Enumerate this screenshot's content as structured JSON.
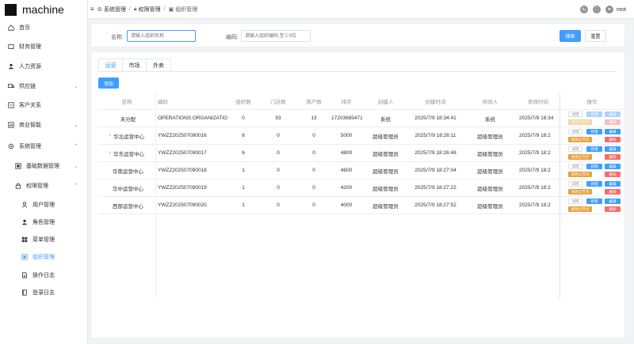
{
  "app": {
    "logo_text": "machine"
  },
  "sidebar": {
    "items": [
      {
        "label": "首页",
        "icon": "home-icon"
      },
      {
        "label": "财务管理",
        "icon": "wallet-icon"
      },
      {
        "label": "人力资源",
        "icon": "person-icon"
      },
      {
        "label": "供应链",
        "icon": "truck-icon"
      },
      {
        "label": "客户关系",
        "icon": "handshake-icon"
      },
      {
        "label": "商业智能",
        "icon": "chart-icon"
      },
      {
        "label": "系统管理",
        "icon": "gear-icon"
      },
      {
        "label": "基础数据管理",
        "icon": "database-icon"
      },
      {
        "label": "权限管理",
        "icon": "lock-icon"
      },
      {
        "label": "用户管理",
        "icon": "user-icon"
      },
      {
        "label": "角色管理",
        "icon": "role-icon"
      },
      {
        "label": "菜单管理",
        "icon": "grid-icon"
      },
      {
        "label": "组织管理",
        "icon": "org-icon"
      },
      {
        "label": "操作日志",
        "icon": "doc-icon"
      },
      {
        "label": "登录日志",
        "icon": "book-icon"
      }
    ]
  },
  "header": {
    "breadcrumb": [
      "系统管理",
      "权限管理",
      "组织管理"
    ],
    "user": "root"
  },
  "search": {
    "name_label": "名称:",
    "name_placeholder": "请输入组织名称",
    "code_label": "编码:",
    "code_placeholder": "请输入组织编码,至少3位",
    "search_button": "搜索",
    "reset_button": "重置"
  },
  "tabs": [
    "运营",
    "市场",
    "外卖"
  ],
  "add_button": "添加",
  "table": {
    "headers": [
      "名称",
      "编码",
      "组织数",
      "门店数",
      "用户数",
      "排序",
      "创建人",
      "创建时间",
      "修改人",
      "修改时间",
      "操作"
    ],
    "rows": [
      {
        "name": "未分配",
        "expand": "",
        "code": "OPERATIONS:ORGANIZATION",
        "orgs": "0",
        "stores": "93",
        "users": "13",
        "sort": "17203685471",
        "creator": "系统",
        "created": "2025/7/9 18:34:41",
        "modifier": "系统",
        "modified": "2025/7/9 18:34"
      },
      {
        "name": "华北运营中心",
        "expand": "›",
        "code": "YWZZ202507090016",
        "orgs": "6",
        "stores": "0",
        "users": "0",
        "sort": "5000",
        "creator": "超级管理员",
        "created": "2025/7/9 18:26:11",
        "modifier": "超级管理员",
        "modified": "2025/7/9 18:2"
      },
      {
        "name": "华东运营中心",
        "expand": "›",
        "code": "YWZZ202507090017",
        "orgs": "6",
        "stores": "0",
        "users": "0",
        "sort": "4800",
        "creator": "超级管理员",
        "created": "2025/7/9 18:26:48",
        "modifier": "超级管理员",
        "modified": "2025/7/9 18:2"
      },
      {
        "name": "华南运营中心",
        "expand": "",
        "code": "YWZZ202507090018",
        "orgs": "1",
        "stores": "0",
        "users": "0",
        "sort": "4600",
        "creator": "超级管理员",
        "created": "2025/7/9 18:27:04",
        "modifier": "超级管理员",
        "modified": "2025/7/9 18:2"
      },
      {
        "name": "华中运营中心",
        "expand": "",
        "code": "YWZZ202507090019",
        "orgs": "1",
        "stores": "0",
        "users": "0",
        "sort": "4200",
        "creator": "超级管理员",
        "created": "2025/7/9 18:27:22",
        "modifier": "超级管理员",
        "modified": "2025/7/9 18:2"
      },
      {
        "name": "西部运营中心",
        "expand": "",
        "code": "YWZZ202507090020",
        "orgs": "1",
        "stores": "0",
        "users": "0",
        "sort": "4000",
        "creator": "超级管理员",
        "created": "2025/7/9 18:27:52",
        "modifier": "超级管理员",
        "modified": "2025/7/9 18:2"
      }
    ],
    "ops": {
      "detail": "详情",
      "add": "新增",
      "edit": "编辑",
      "parent": "修改父节点",
      "delete": "删除"
    }
  },
  "colors": {
    "primary": "#409eff",
    "warning": "#e6a23c",
    "danger": "#f56c6c",
    "bg": "#f2f3f5"
  }
}
